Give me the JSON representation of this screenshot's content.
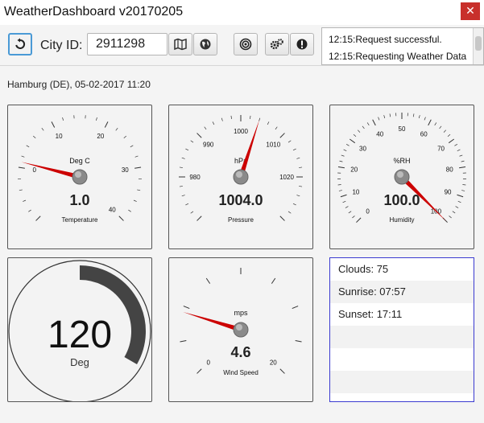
{
  "window": {
    "title": "WeatherDashboard v20170205",
    "close_label": "✕"
  },
  "toolbar": {
    "city_label": "City ID:",
    "city_value": "2911298"
  },
  "icons": [
    "refresh-icon",
    "map-icon",
    "globe-icon",
    "target-icon",
    "settings-icon",
    "alert-icon"
  ],
  "log": {
    "lines": [
      "12:15:Request successful.",
      "12:15:Requesting Weather Data"
    ]
  },
  "location_text": "Hamburg (DE), 05-02-2017 11:20",
  "gauges": {
    "temperature": {
      "unit": "Deg C",
      "value": 1.0,
      "value_text": "1.0",
      "label": "Temperature",
      "min": -10,
      "max": 40,
      "ticks": [
        "0",
        "10",
        "20",
        "30",
        "40"
      ]
    },
    "pressure": {
      "unit": "hPa",
      "value": 1004.0,
      "value_text": "1004.0",
      "label": "Pressure",
      "min": 970,
      "max": 1030,
      "ticks": [
        "980",
        "990",
        "1000",
        "1010",
        "1020"
      ]
    },
    "humidity": {
      "unit": "%RH",
      "value": 100.0,
      "value_text": "100.0",
      "label": "Humidity",
      "min": 0,
      "max": 100,
      "ticks": [
        "0",
        "10",
        "20",
        "30",
        "40",
        "50",
        "60",
        "70",
        "80",
        "90",
        "100"
      ]
    },
    "wind_dir": {
      "value": 120,
      "value_text": "120",
      "unit": "Deg"
    },
    "wind_speed": {
      "unit": "mps",
      "value": 4.6,
      "value_text": "4.6",
      "label": "Wind Speed",
      "min": 0,
      "max": 20,
      "ticks": [
        "0",
        "20"
      ]
    }
  },
  "info": {
    "rows": [
      "Clouds: 75",
      "Sunrise: 07:57",
      "Sunset: 17:11",
      "",
      "",
      ""
    ]
  },
  "colors": {
    "needle": "#cc0000",
    "accent": "#4a9ad6",
    "info_border": "#3a3ad0",
    "close": "#c8302b"
  }
}
